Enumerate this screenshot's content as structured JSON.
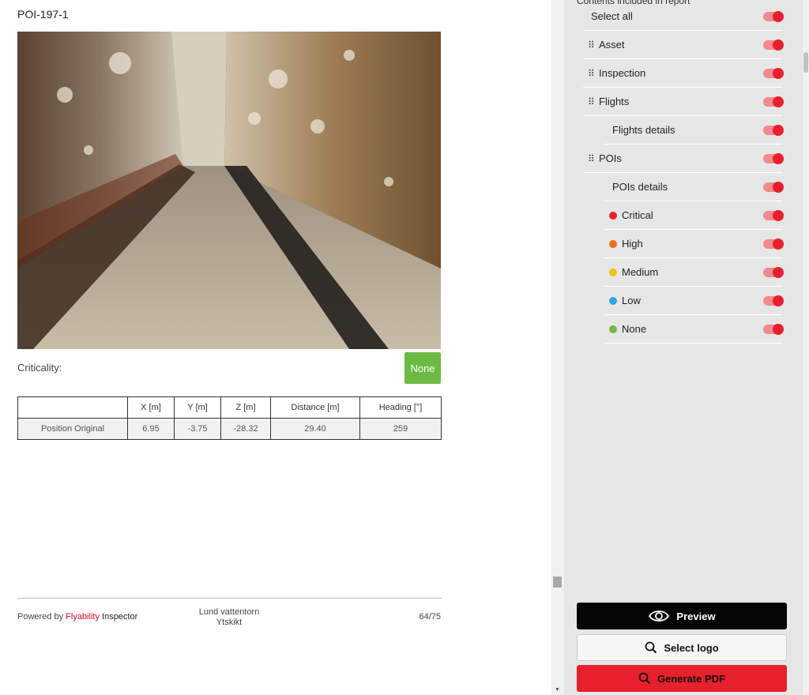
{
  "report": {
    "poi_title": "POI-197-1",
    "criticality_label": "Criticality:",
    "criticality_value": "None",
    "criticality_color": "#6cba43",
    "table": {
      "headers": [
        "",
        "X [m]",
        "Y [m]",
        "Z [m]",
        "Distance [m]",
        "Heading [°]"
      ],
      "rows": [
        [
          "Position Original",
          "6.95",
          "-3.75",
          "-28.32",
          "29.40",
          "259"
        ]
      ]
    },
    "footer": {
      "powered_by": "Powered by",
      "brand": "Flyability",
      "brand_suffix": "Inspector",
      "location_line1": "Lund vattentorn",
      "location_line2": "Ytskikt",
      "page": "64/75"
    }
  },
  "panel": {
    "section_title": "Contents included in report",
    "items": [
      {
        "label": "Select all",
        "drag": false,
        "dot": null,
        "indent": 0
      },
      {
        "label": "Asset",
        "drag": true,
        "dot": null,
        "indent": 0
      },
      {
        "label": "Inspection",
        "drag": true,
        "dot": null,
        "indent": 0
      },
      {
        "label": "Flights",
        "drag": true,
        "dot": null,
        "indent": 0
      },
      {
        "label": "Flights details",
        "drag": false,
        "dot": null,
        "indent": 1
      },
      {
        "label": "POIs",
        "drag": true,
        "dot": null,
        "indent": 0
      },
      {
        "label": "POIs details",
        "drag": false,
        "dot": null,
        "indent": 1
      },
      {
        "label": "Critical",
        "drag": false,
        "dot": "#e8202d",
        "indent": 1
      },
      {
        "label": "High",
        "drag": false,
        "dot": "#e8701a",
        "indent": 1
      },
      {
        "label": "Medium",
        "drag": false,
        "dot": "#f0c419",
        "indent": 1
      },
      {
        "label": "Low",
        "drag": false,
        "dot": "#29a8e0",
        "indent": 1
      },
      {
        "label": "None",
        "drag": false,
        "dot": "#6cba43",
        "indent": 1
      }
    ],
    "buttons": {
      "preview": "Preview",
      "select_logo": "Select logo",
      "generate_pdf": "Generate PDF"
    }
  },
  "colors": {
    "accent_red": "#e8202d",
    "toggle_track": "#f08a8f",
    "preview_bg": "#050505"
  }
}
